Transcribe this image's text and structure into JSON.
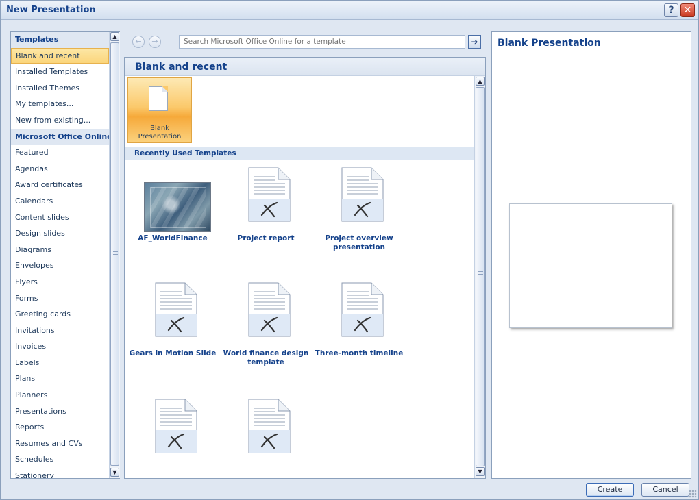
{
  "window": {
    "title": "New Presentation",
    "help_label": "?",
    "close_label": "✕"
  },
  "left": {
    "items": [
      {
        "label": "Templates",
        "kind": "header"
      },
      {
        "label": "Blank and recent",
        "kind": "selected"
      },
      {
        "label": "Installed Templates",
        "kind": "item"
      },
      {
        "label": "Installed Themes",
        "kind": "item"
      },
      {
        "label": "My templates...",
        "kind": "item"
      },
      {
        "label": "New from existing...",
        "kind": "item"
      },
      {
        "label": "Microsoft Office Online",
        "kind": "header"
      },
      {
        "label": "Featured",
        "kind": "item"
      },
      {
        "label": "Agendas",
        "kind": "item"
      },
      {
        "label": "Award certificates",
        "kind": "item"
      },
      {
        "label": "Calendars",
        "kind": "item"
      },
      {
        "label": "Content slides",
        "kind": "item"
      },
      {
        "label": "Design slides",
        "kind": "item"
      },
      {
        "label": "Diagrams",
        "kind": "item"
      },
      {
        "label": "Envelopes",
        "kind": "item"
      },
      {
        "label": "Flyers",
        "kind": "item"
      },
      {
        "label": "Forms",
        "kind": "item"
      },
      {
        "label": "Greeting cards",
        "kind": "item"
      },
      {
        "label": "Invitations",
        "kind": "item"
      },
      {
        "label": "Invoices",
        "kind": "item"
      },
      {
        "label": "Labels",
        "kind": "item"
      },
      {
        "label": "Plans",
        "kind": "item"
      },
      {
        "label": "Planners",
        "kind": "item"
      },
      {
        "label": "Presentations",
        "kind": "item"
      },
      {
        "label": "Reports",
        "kind": "item"
      },
      {
        "label": "Resumes and CVs",
        "kind": "item"
      },
      {
        "label": "Schedules",
        "kind": "item"
      },
      {
        "label": "Stationery",
        "kind": "item"
      }
    ]
  },
  "navbar": {
    "back_icon": "back-arrow-icon",
    "forward_icon": "forward-arrow-icon",
    "search_placeholder": "Search Microsoft Office Online for a template",
    "go_icon": "go-arrow-icon"
  },
  "middle": {
    "title": "Blank and recent",
    "blank_tile_label": "Blank Presentation",
    "recent_section_title": "Recently Used Templates",
    "templates": [
      {
        "label": "AF_WorldFinance",
        "thumbnail": "image"
      },
      {
        "label": "Project report",
        "thumbnail": "document"
      },
      {
        "label": "Project overview presentation",
        "thumbnail": "document"
      },
      {
        "label": "Gears in Motion Slide",
        "thumbnail": "document"
      },
      {
        "label": "World finance design template",
        "thumbnail": "document"
      },
      {
        "label": "Three-month timeline",
        "thumbnail": "document"
      },
      {
        "label": "",
        "thumbnail": "document"
      },
      {
        "label": "",
        "thumbnail": "document"
      }
    ]
  },
  "right": {
    "title": "Blank Presentation"
  },
  "buttons": {
    "create_label": "Create",
    "cancel_label": "Cancel"
  },
  "colors": {
    "accent": "#15428b",
    "selected_fill": "#fbd57a",
    "pane_bg": "#dfe7f2"
  }
}
